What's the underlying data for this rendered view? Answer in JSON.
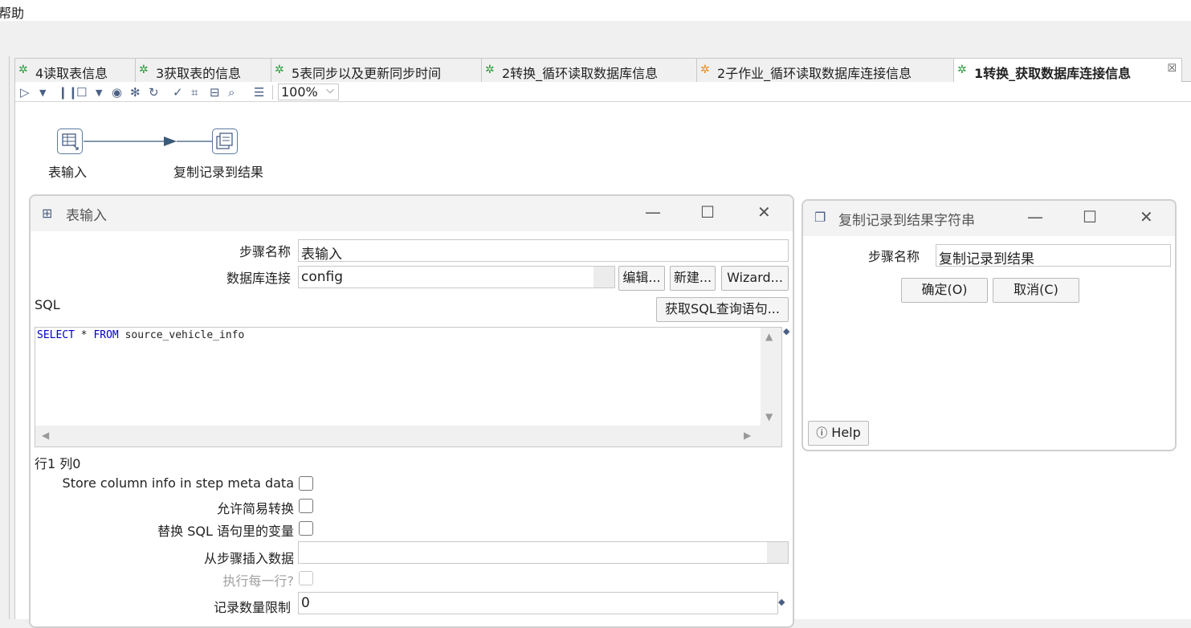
{
  "menu": {
    "help": "帮助"
  },
  "tabs": [
    {
      "label": "4读取表信息",
      "icon": "transformation-icon"
    },
    {
      "label": "3获取表的信息",
      "icon": "transformation-icon"
    },
    {
      "label": "5表同步以及更新同步时间",
      "icon": "transformation-icon"
    },
    {
      "label": "2转换_循环读取数据库信息",
      "icon": "transformation-icon"
    },
    {
      "label": "2子作业_循环读取数据库连接信息",
      "icon": "job-icon"
    },
    {
      "label": "1转换_获取数据库连接信息",
      "icon": "transformation-icon",
      "active": true,
      "close": "☒"
    }
  ],
  "canvas_toolbar": {
    "zoom": "100%"
  },
  "canvas": {
    "step1": "表输入",
    "step2": "复制记录到结果"
  },
  "table_input_dialog": {
    "title": "表输入",
    "step_name_label": "步骤名称",
    "step_name_value": "表输入",
    "db_conn_label": "数据库连接",
    "db_conn_value": "config",
    "edit_btn": "编辑...",
    "new_btn": "新建...",
    "wizard_btn": "Wizard...",
    "sql_label": "SQL",
    "get_sql_btn": "获取SQL查询语句...",
    "sql_kw1": "SELECT",
    "sql_mid": " * ",
    "sql_kw2": "FROM",
    "sql_rest": " source_vehicle_info",
    "position": "行1 列0",
    "store_col_label": "Store column info in step meta data",
    "lazy_conv_label": "允许简易转换",
    "replace_var_label": "替换 SQL 语句里的变量",
    "insert_from_label": "从步骤插入数据",
    "exec_each_label": "执行每一行?",
    "limit_label": "记录数量限制",
    "limit_value": "0"
  },
  "copy_rows_dialog": {
    "title": "复制记录到结果字符串",
    "step_name_label": "步骤名称",
    "step_name_value": "复制记录到结果",
    "ok_btn": "确定(O)",
    "cancel_btn": "取消(C)",
    "help_btn": "Help"
  },
  "colors": {
    "accent": "#4a5f84",
    "sql_keyword": "#0000c8",
    "tab_icon_green": "#2a9a3a",
    "tab_icon_orange": "#e88a1a"
  }
}
